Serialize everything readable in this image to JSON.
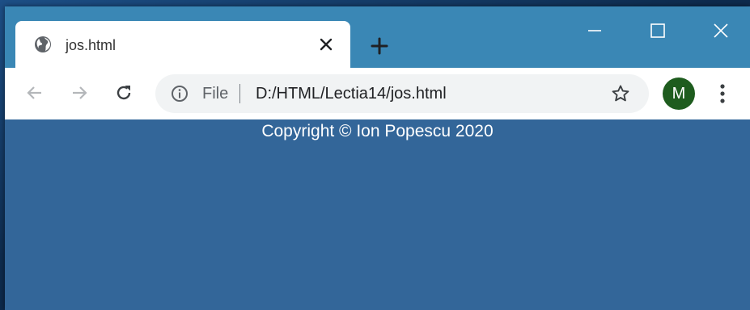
{
  "browser": {
    "tab": {
      "title": "jos.html",
      "favicon": "globe-icon"
    },
    "new_tab_icon": "plus-icon",
    "window_controls": [
      "minimize-icon",
      "maximize-icon",
      "close-icon"
    ],
    "address_bar": {
      "scheme_label": "File",
      "url": "D:/HTML/Lectia14/jos.html"
    },
    "profile": {
      "initial": "M"
    }
  },
  "page": {
    "footer_text": "Copyright © Ion Popescu 2020",
    "background_color": "#336699"
  },
  "colors": {
    "titlebar": "#3a87b5",
    "avatar": "#1e5c1e"
  }
}
